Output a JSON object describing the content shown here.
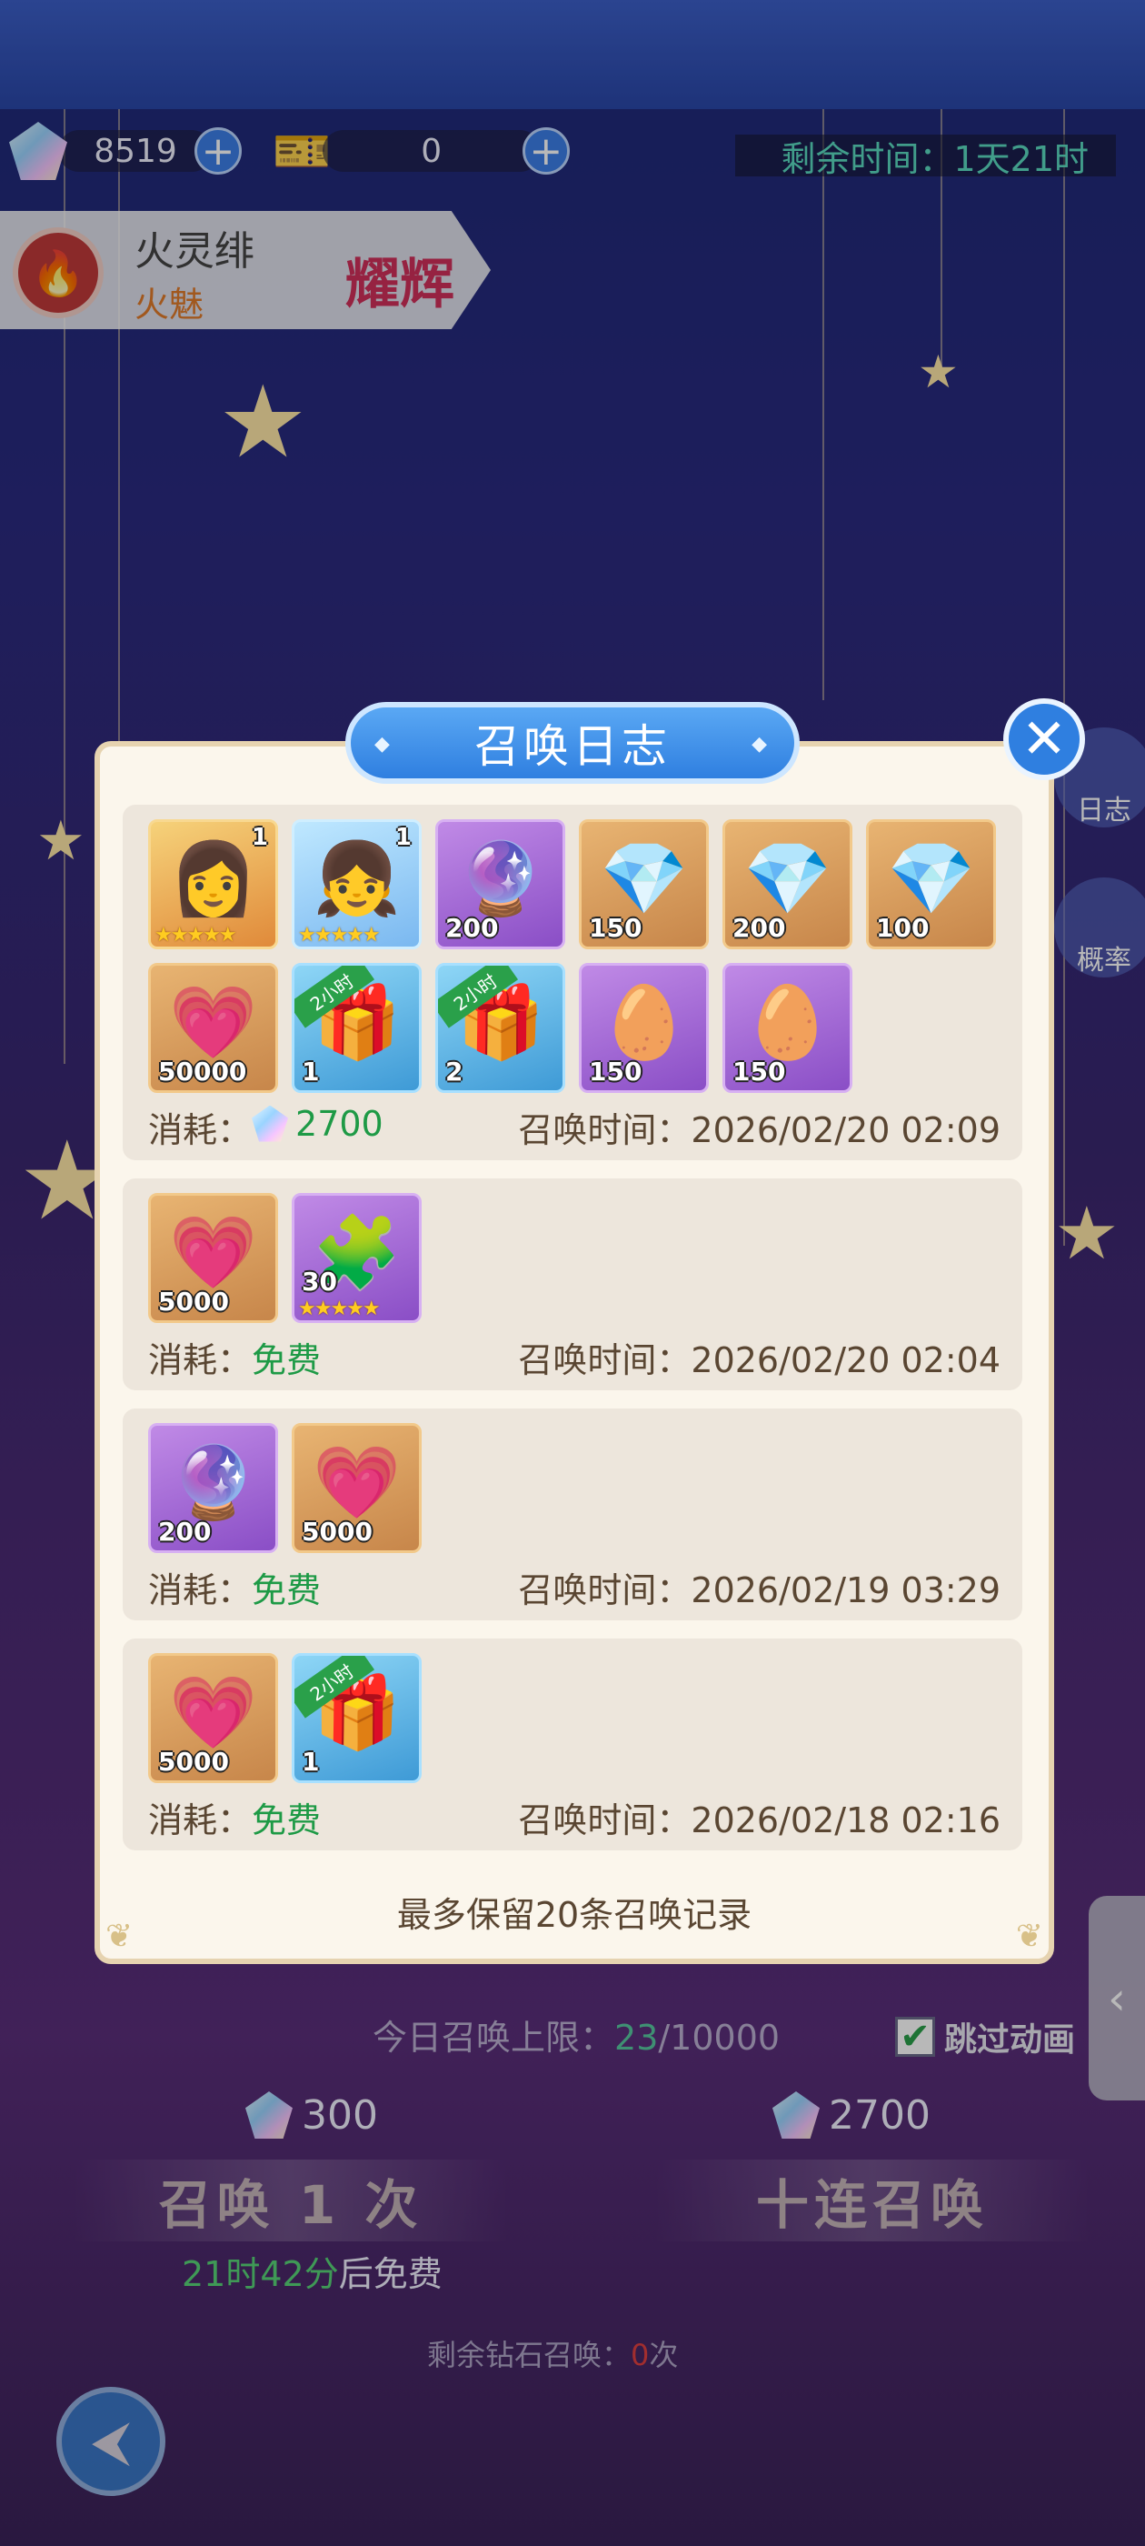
{
  "top": {
    "diamond_count": "8519",
    "ticket_count": "0",
    "remaining_label": "剩余时间：",
    "remaining_value": "1天21时"
  },
  "hero": {
    "name": "火灵绯",
    "subtitle": "火魅",
    "rank": "耀辉"
  },
  "side_buttons": {
    "log": "日志",
    "rate": "概率"
  },
  "dialog": {
    "title": "召唤日志",
    "footer": "最多保留20条召唤记录",
    "cost_label": "消耗：",
    "time_label": "召唤时间：",
    "records": [
      {
        "cost": "2700",
        "cost_is_diamond": true,
        "time": "2026/02/20 02:09",
        "items": [
          {
            "type": "portrait-red",
            "icon": "hero-portrait-icon",
            "glyph": "👩",
            "level": "1",
            "stars": "★★★★★"
          },
          {
            "type": "portrait-blue",
            "icon": "hero-portrait-icon",
            "glyph": "👧",
            "level": "1",
            "stars": "★★★★★"
          },
          {
            "type": "purple",
            "icon": "crystal-orb-icon",
            "glyph": "🔮",
            "count": "200"
          },
          {
            "type": "gold",
            "icon": "diamond-icon",
            "glyph": "💎",
            "count": "150"
          },
          {
            "type": "gold",
            "icon": "diamond-icon",
            "glyph": "💎",
            "count": "200"
          },
          {
            "type": "gold",
            "icon": "diamond-icon",
            "glyph": "💎",
            "count": "100"
          },
          {
            "type": "gold",
            "icon": "exp-heart-icon",
            "glyph": "💗",
            "count": "50000"
          },
          {
            "type": "blue",
            "icon": "treasure-chest-icon",
            "glyph": "🎁",
            "count": "1",
            "ribbon": "2小时"
          },
          {
            "type": "blue",
            "icon": "treasure-chest-icon",
            "glyph": "🎁",
            "count": "2",
            "ribbon": "2小时"
          },
          {
            "type": "purple",
            "icon": "golden-egg-icon",
            "glyph": "🥚",
            "count": "150"
          },
          {
            "type": "purple",
            "icon": "golden-egg-icon",
            "glyph": "🥚",
            "count": "150"
          }
        ]
      },
      {
        "cost": "免费",
        "cost_is_diamond": false,
        "time": "2026/02/20 02:04",
        "items": [
          {
            "type": "gold",
            "icon": "exp-heart-icon",
            "glyph": "💗",
            "count": "5000"
          },
          {
            "type": "purple",
            "icon": "hero-shard-icon",
            "glyph": "🧩",
            "count": "30",
            "stars": "★★★★★"
          }
        ]
      },
      {
        "cost": "免费",
        "cost_is_diamond": false,
        "time": "2026/02/19 03:29",
        "items": [
          {
            "type": "purple",
            "icon": "crystal-orb-icon",
            "glyph": "🔮",
            "count": "200"
          },
          {
            "type": "gold",
            "icon": "exp-heart-icon",
            "glyph": "💗",
            "count": "5000"
          }
        ]
      },
      {
        "cost": "免费",
        "cost_is_diamond": false,
        "time": "2026/02/18 02:16",
        "items": [
          {
            "type": "gold",
            "icon": "exp-heart-icon",
            "glyph": "💗",
            "count": "5000"
          },
          {
            "type": "blue",
            "icon": "treasure-chest-icon",
            "glyph": "🎁",
            "count": "1",
            "ribbon": "2小时"
          }
        ]
      }
    ]
  },
  "bottom": {
    "limit_label": "今日召唤上限：",
    "limit_used": "23",
    "limit_total": "/10000",
    "skip_label": "跳过动画",
    "single_cost": "300",
    "multi_cost": "2700",
    "single_label": "召唤 1 次",
    "multi_label": "十连召唤",
    "free_time": "21时42分",
    "free_suffix": "后免费",
    "diamond_left_prefix": "剩余钻石召唤：",
    "diamond_left_count": "0",
    "diamond_left_suffix": "次"
  },
  "colors": {
    "accent_blue": "#2f7fe0",
    "free_green": "#1e9a46",
    "dialog_bg": "#fbf6ec"
  }
}
